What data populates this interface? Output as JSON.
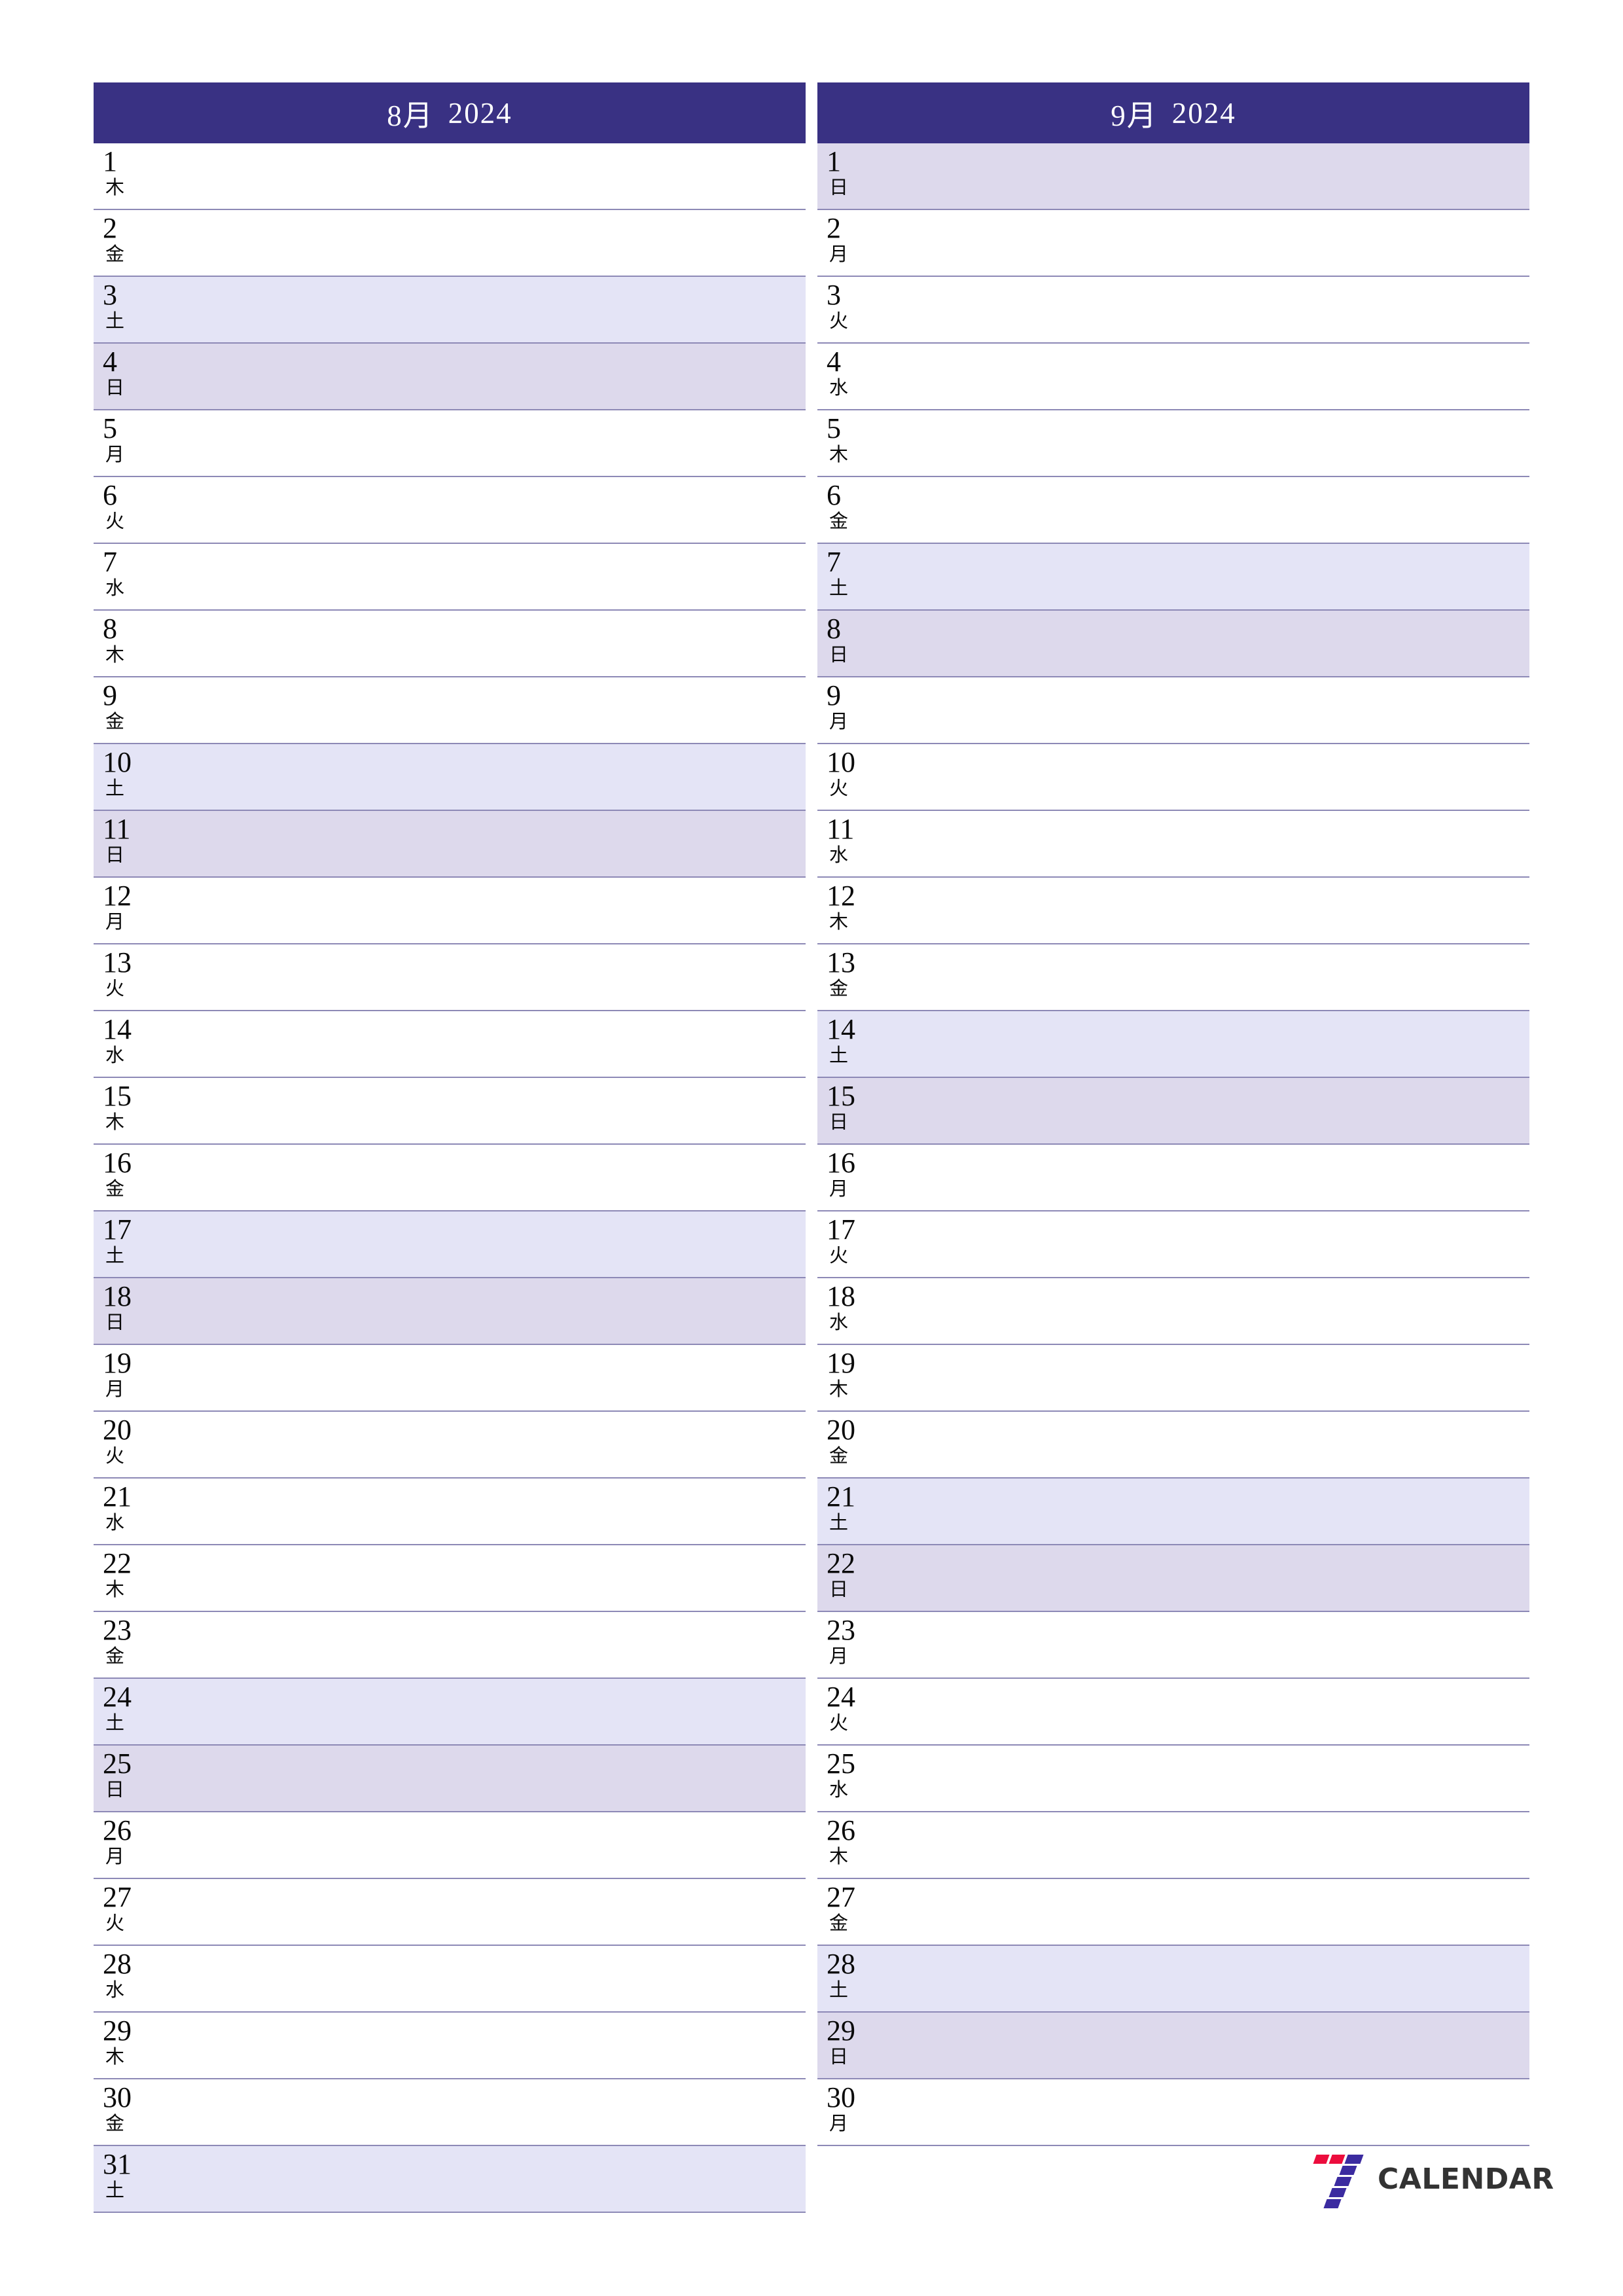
{
  "document": {
    "type": "monthly-planner",
    "background_color": "#ffffff",
    "header_color": "#393183",
    "saturday_color": "#e4e4f6",
    "sunday_color": "#ddd9ec",
    "grid_line_color": "#8d89b6",
    "text_color": "#0a0a0a"
  },
  "months": [
    {
      "month_label": "8月",
      "year_label": "2024",
      "days": [
        {
          "num": "1",
          "weekday": "木",
          "type": "weekday"
        },
        {
          "num": "2",
          "weekday": "金",
          "type": "weekday"
        },
        {
          "num": "3",
          "weekday": "土",
          "type": "sat"
        },
        {
          "num": "4",
          "weekday": "日",
          "type": "sun"
        },
        {
          "num": "5",
          "weekday": "月",
          "type": "weekday"
        },
        {
          "num": "6",
          "weekday": "火",
          "type": "weekday"
        },
        {
          "num": "7",
          "weekday": "水",
          "type": "weekday"
        },
        {
          "num": "8",
          "weekday": "木",
          "type": "weekday"
        },
        {
          "num": "9",
          "weekday": "金",
          "type": "weekday"
        },
        {
          "num": "10",
          "weekday": "土",
          "type": "sat"
        },
        {
          "num": "11",
          "weekday": "日",
          "type": "sun"
        },
        {
          "num": "12",
          "weekday": "月",
          "type": "weekday"
        },
        {
          "num": "13",
          "weekday": "火",
          "type": "weekday"
        },
        {
          "num": "14",
          "weekday": "水",
          "type": "weekday"
        },
        {
          "num": "15",
          "weekday": "木",
          "type": "weekday"
        },
        {
          "num": "16",
          "weekday": "金",
          "type": "weekday"
        },
        {
          "num": "17",
          "weekday": "土",
          "type": "sat"
        },
        {
          "num": "18",
          "weekday": "日",
          "type": "sun"
        },
        {
          "num": "19",
          "weekday": "月",
          "type": "weekday"
        },
        {
          "num": "20",
          "weekday": "火",
          "type": "weekday"
        },
        {
          "num": "21",
          "weekday": "水",
          "type": "weekday"
        },
        {
          "num": "22",
          "weekday": "木",
          "type": "weekday"
        },
        {
          "num": "23",
          "weekday": "金",
          "type": "weekday"
        },
        {
          "num": "24",
          "weekday": "土",
          "type": "sat"
        },
        {
          "num": "25",
          "weekday": "日",
          "type": "sun"
        },
        {
          "num": "26",
          "weekday": "月",
          "type": "weekday"
        },
        {
          "num": "27",
          "weekday": "火",
          "type": "weekday"
        },
        {
          "num": "28",
          "weekday": "水",
          "type": "weekday"
        },
        {
          "num": "29",
          "weekday": "木",
          "type": "weekday"
        },
        {
          "num": "30",
          "weekday": "金",
          "type": "weekday"
        },
        {
          "num": "31",
          "weekday": "土",
          "type": "sat"
        }
      ]
    },
    {
      "month_label": "9月",
      "year_label": "2024",
      "days": [
        {
          "num": "1",
          "weekday": "日",
          "type": "sun"
        },
        {
          "num": "2",
          "weekday": "月",
          "type": "weekday"
        },
        {
          "num": "3",
          "weekday": "火",
          "type": "weekday"
        },
        {
          "num": "4",
          "weekday": "水",
          "type": "weekday"
        },
        {
          "num": "5",
          "weekday": "木",
          "type": "weekday"
        },
        {
          "num": "6",
          "weekday": "金",
          "type": "weekday"
        },
        {
          "num": "7",
          "weekday": "土",
          "type": "sat"
        },
        {
          "num": "8",
          "weekday": "日",
          "type": "sun"
        },
        {
          "num": "9",
          "weekday": "月",
          "type": "weekday"
        },
        {
          "num": "10",
          "weekday": "火",
          "type": "weekday"
        },
        {
          "num": "11",
          "weekday": "水",
          "type": "weekday"
        },
        {
          "num": "12",
          "weekday": "木",
          "type": "weekday"
        },
        {
          "num": "13",
          "weekday": "金",
          "type": "weekday"
        },
        {
          "num": "14",
          "weekday": "土",
          "type": "sat"
        },
        {
          "num": "15",
          "weekday": "日",
          "type": "sun"
        },
        {
          "num": "16",
          "weekday": "月",
          "type": "weekday"
        },
        {
          "num": "17",
          "weekday": "火",
          "type": "weekday"
        },
        {
          "num": "18",
          "weekday": "水",
          "type": "weekday"
        },
        {
          "num": "19",
          "weekday": "木",
          "type": "weekday"
        },
        {
          "num": "20",
          "weekday": "金",
          "type": "weekday"
        },
        {
          "num": "21",
          "weekday": "土",
          "type": "sat"
        },
        {
          "num": "22",
          "weekday": "日",
          "type": "sun"
        },
        {
          "num": "23",
          "weekday": "月",
          "type": "weekday"
        },
        {
          "num": "24",
          "weekday": "火",
          "type": "weekday"
        },
        {
          "num": "25",
          "weekday": "水",
          "type": "weekday"
        },
        {
          "num": "26",
          "weekday": "木",
          "type": "weekday"
        },
        {
          "num": "27",
          "weekday": "金",
          "type": "weekday"
        },
        {
          "num": "28",
          "weekday": "土",
          "type": "sat"
        },
        {
          "num": "29",
          "weekday": "日",
          "type": "sun"
        },
        {
          "num": "30",
          "weekday": "月",
          "type": "weekday"
        }
      ]
    }
  ],
  "logo": {
    "mark_name": "seven-mark-icon",
    "wordmark": "CALENDAR",
    "red_color": "#ec0d3d",
    "purple_color": "#3b2ba0",
    "word_color": "#333333"
  }
}
